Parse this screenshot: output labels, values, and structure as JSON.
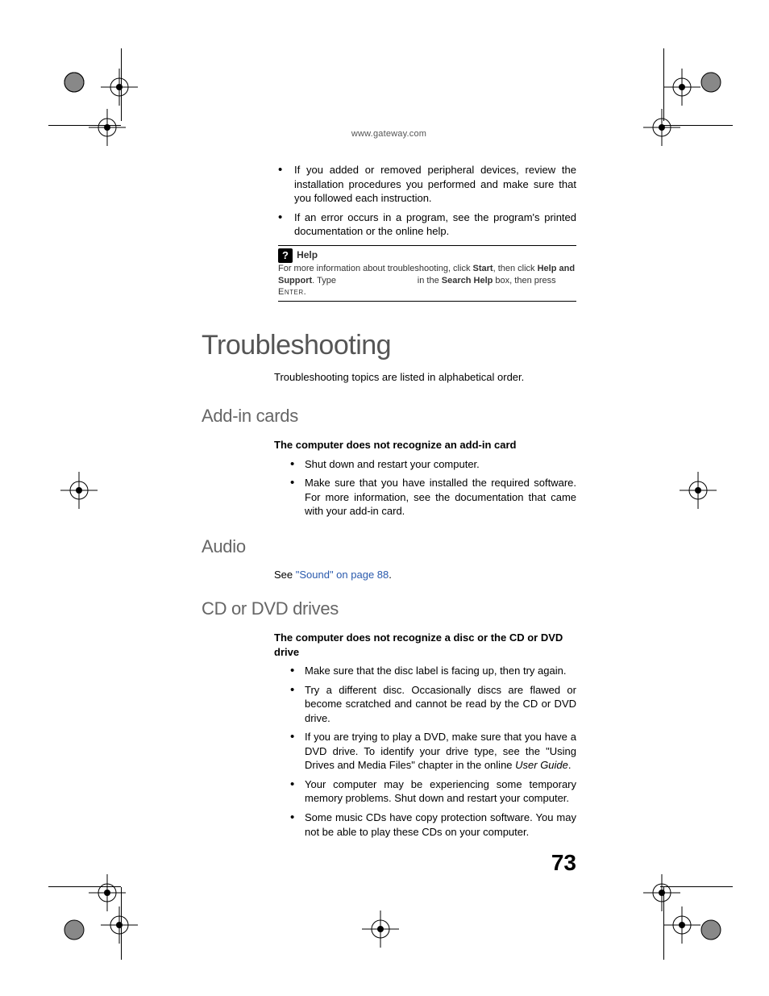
{
  "header": {
    "url": "www.gateway.com"
  },
  "intro_bullets": [
    "If you added or removed peripheral devices, review the installation procedures you performed and make sure that you followed each instruction.",
    "If an error occurs in a program, see the program's printed documentation or the online help."
  ],
  "help_box": {
    "title": "Help",
    "text_pre": "For more information about troubleshooting, click ",
    "start": "Start",
    "text_mid1": ", then click ",
    "help_support": "Help and Support",
    "text_mid2": ". Type ",
    "text_mid3": " in the ",
    "search_help": "Search Help",
    "text_mid4": " box, then press ",
    "enter": "Enter",
    "text_end": "."
  },
  "title": "Troubleshooting",
  "intro_line": "Troubleshooting topics are listed in alphabetical order.",
  "sections": {
    "addin": {
      "heading": "Add-in cards",
      "subhead": "The computer does not recognize an add-in card",
      "bullets": [
        "Shut down and restart your computer.",
        "Make sure that you have installed the required software. For more information, see the documentation that came with your add-in card."
      ]
    },
    "audio": {
      "heading": "Audio",
      "see_pre": "See ",
      "see_link": "\"Sound\" on page 88",
      "see_post": "."
    },
    "cddvd": {
      "heading": "CD or DVD drives",
      "subhead": "The computer does not recognize a disc or the CD or DVD drive",
      "bullets": [
        "Make sure that the disc label is facing up, then try again.",
        "Try a different disc. Occasionally discs are flawed or become scratched and cannot be read by the CD or DVD drive.",
        "If you are trying to play a DVD, make sure that you have a DVD drive. To identify your drive type, see the \"Using Drives and Media Files\" chapter in the online User Guide.",
        "Your computer may be experiencing some temporary memory problems. Shut down and restart your computer.",
        "Some music CDs have copy protection software. You may not be able to play these CDs on your computer."
      ]
    }
  },
  "page_number": "73"
}
